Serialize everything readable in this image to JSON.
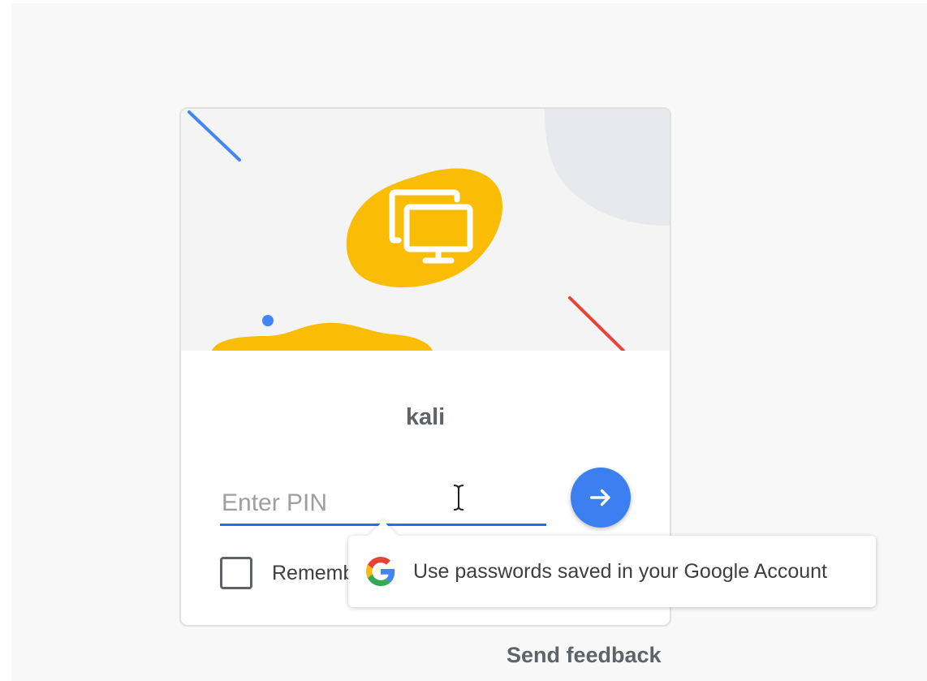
{
  "card": {
    "username": "kali",
    "pin": {
      "value": "",
      "placeholder": "Enter PIN"
    },
    "remember_label": "Remember"
  },
  "autofill": {
    "text": "Use passwords saved in your Google Account"
  },
  "footer": {
    "send_feedback": "Send feedback"
  },
  "icons": {
    "hero": "remote-desktop-icon",
    "submit": "arrow-right-icon",
    "autofill": "google-g-icon"
  },
  "colors": {
    "accent_blue": "#1a73e8",
    "button_blue": "#3c7ff0",
    "hero_yellow": "#fbbc05",
    "line_red": "#ea4335",
    "text_gray": "#5f6368"
  }
}
